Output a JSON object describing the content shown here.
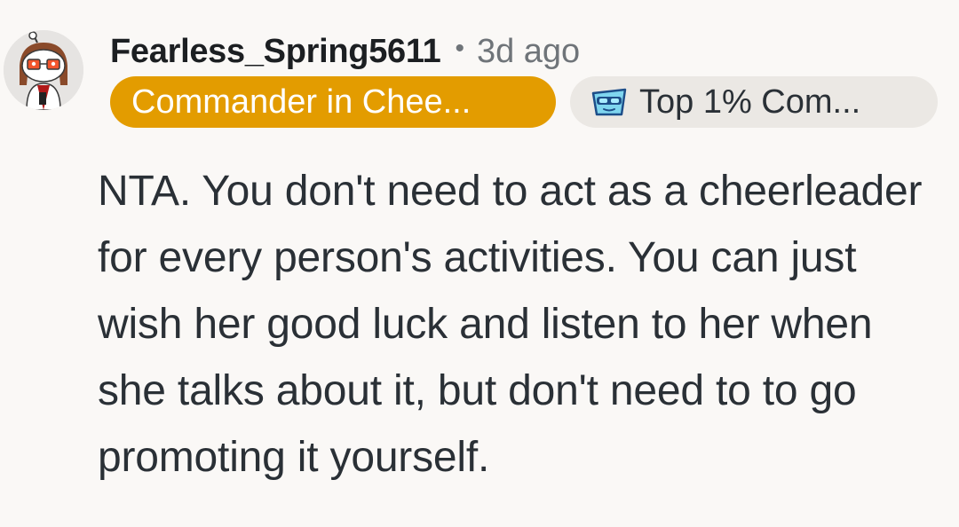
{
  "comment": {
    "author": "Fearless_Spring5611",
    "separator": "•",
    "timestamp": "3d ago",
    "avatar_icon": "snoo-avatar-icon",
    "flairs": {
      "user_flair": {
        "label": "Commander in Chee...",
        "color": "#e39c00"
      },
      "achievement_flair": {
        "label": "Top 1% Com...",
        "icon": "achievement-badge-icon",
        "color": "#ebe8e4"
      }
    },
    "body": "NTA. You don't need to act as a cheerleader for every person's activities. You can just wish her good luck and listen to her when she talks about it, but don't need to to go promoting it yourself."
  }
}
